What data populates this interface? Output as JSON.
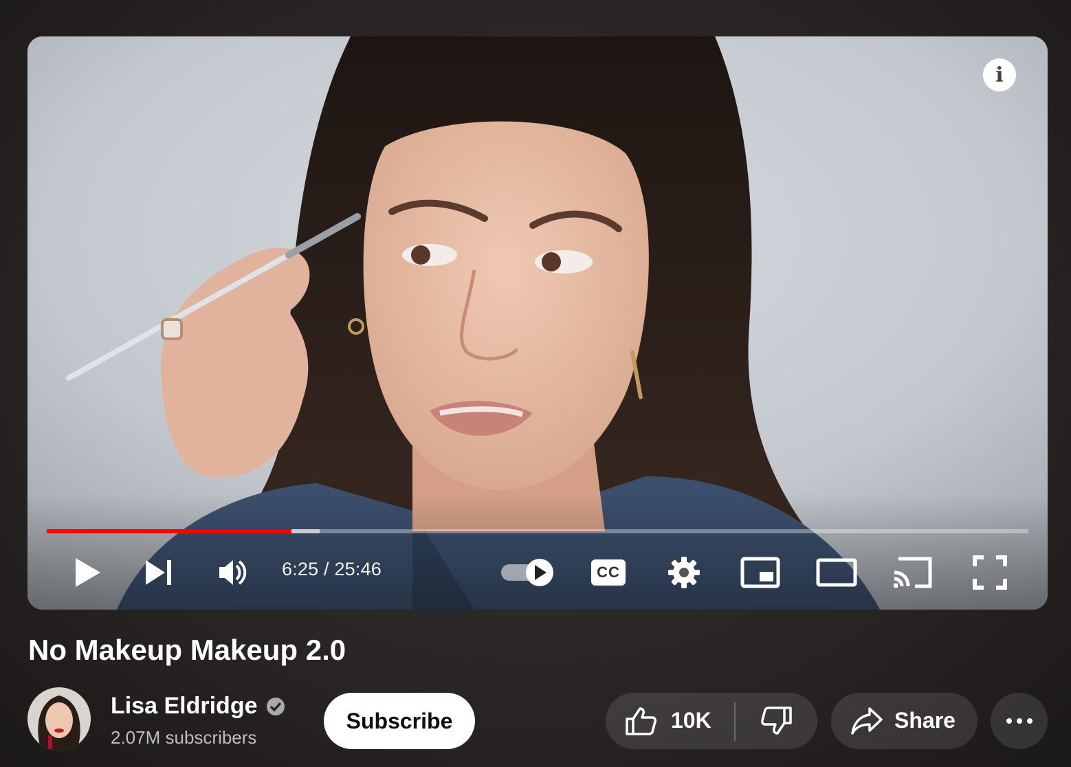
{
  "video": {
    "title": "No Makeup Makeup 2.0",
    "current_time": "6:25",
    "duration": "25:46",
    "time_display": "6:25 / 25:46",
    "played_fraction": 0.249,
    "buffered_fraction": 0.278,
    "autoplay_on": true,
    "info_label": "i",
    "cc_label": "CC"
  },
  "channel": {
    "name": "Lisa Eldridge",
    "verified": true,
    "subscribers": "2.07M subscribers"
  },
  "actions": {
    "subscribe_label": "Subscribe",
    "like_count": "10K",
    "share_label": "Share"
  },
  "colors": {
    "progress_played": "#ff0000",
    "page_background": "#2a2625",
    "button_white": "#ffffff"
  },
  "icons": {
    "controls": [
      "play-icon",
      "next-icon",
      "volume-icon",
      "autoplay-toggle",
      "cc-icon",
      "gear-icon",
      "miniplayer-icon",
      "theater-mode-icon",
      "cast-icon",
      "fullscreen-icon"
    ],
    "actions": [
      "thumbs-up-icon",
      "thumbs-down-icon",
      "share-arrow-icon",
      "more-dots-icon"
    ]
  }
}
